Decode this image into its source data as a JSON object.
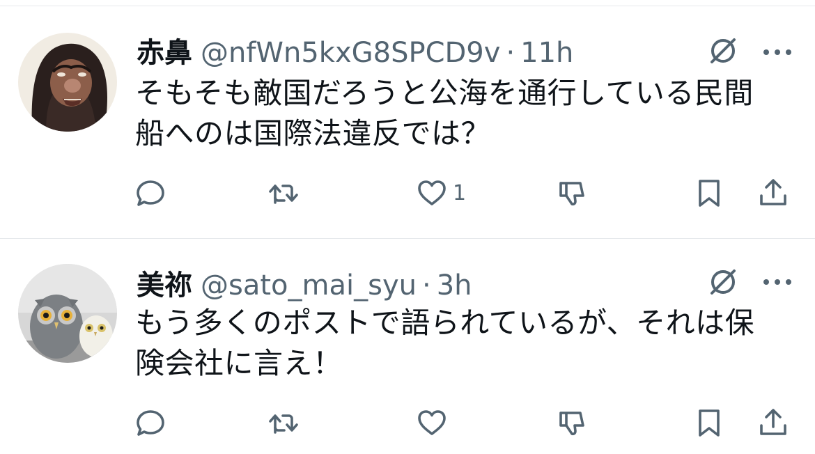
{
  "posts": [
    {
      "display_name": "赤鼻",
      "handle": "@nfWn5kxG8SPCD9v",
      "separator": "·",
      "time": "11h",
      "text_lines": [
        "そもそも敵国だろうと公海を通行している民間",
        "船へのは国際法違反では？"
      ],
      "like_count": "1",
      "avatar_icon": "hooded-character-avatar"
    },
    {
      "display_name": "美祢",
      "handle": "@sato_mai_syu",
      "separator": "·",
      "time": "3h",
      "text_lines": [
        "もう多くのポストで語られているが、それは保",
        "険会社に言え！"
      ],
      "like_count": "",
      "avatar_icon": "owl-figurines-avatar"
    }
  ],
  "icons": {
    "grok": "grok-icon",
    "more": "more-icon",
    "reply": "reply-icon",
    "repost": "repost-icon",
    "like": "heart-icon",
    "dislike": "thumbs-down-icon",
    "bookmark": "bookmark-icon",
    "share": "share-icon"
  },
  "colors": {
    "text": "#0f1419",
    "secondary": "#536471",
    "divider": "#e6e9ec"
  }
}
